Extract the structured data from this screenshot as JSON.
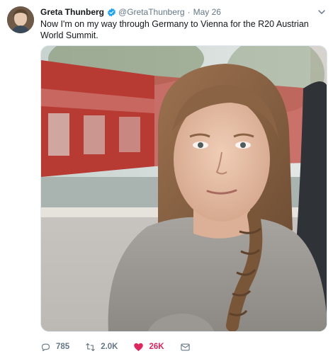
{
  "tweet": {
    "author_name": "Greta Thunberg",
    "handle": "@GretaThunberg",
    "separator": "·",
    "date": "May 26",
    "text": "Now I'm on my way through Germany to Vienna for the R20 Austrian World Summit.",
    "verified": true
  },
  "actions": {
    "reply_count": "785",
    "retweet_count": "2.0K",
    "like_count": "26K",
    "liked": true
  },
  "colors": {
    "verified_blue": "#1da1f2",
    "like_red": "#e0245e",
    "secondary_text": "#657786"
  },
  "icons": [
    "verified-badge-icon",
    "chevron-down-icon",
    "reply-icon",
    "retweet-icon",
    "heart-icon",
    "direct-message-icon"
  ]
}
